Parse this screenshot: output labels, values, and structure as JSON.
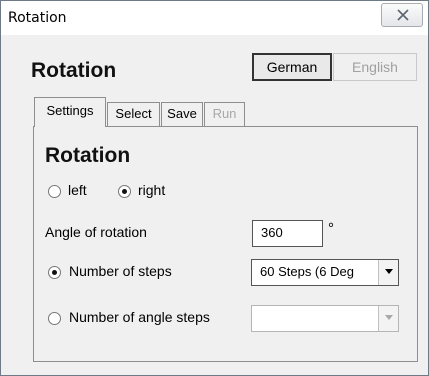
{
  "window": {
    "title": "Rotation",
    "close_glyph": "✕"
  },
  "header": {
    "title": "Rotation",
    "languages": [
      "German",
      "English"
    ],
    "active_language": "German"
  },
  "tabs": [
    {
      "label": "Settings",
      "active": true,
      "enabled": true
    },
    {
      "label": "Select",
      "active": false,
      "enabled": true
    },
    {
      "label": "Save",
      "active": false,
      "enabled": true
    },
    {
      "label": "Run",
      "active": false,
      "enabled": false
    }
  ],
  "settings": {
    "heading": "Rotation",
    "direction": {
      "options": [
        "left",
        "right"
      ],
      "selected": "right"
    },
    "angle": {
      "label": "Angle of rotation",
      "value": "360",
      "unit": "°"
    },
    "mode": {
      "steps_label": "Number of steps",
      "steps_value": "60 Steps  (6 Deg",
      "angle_steps_label": "Number of angle steps",
      "angle_steps_value": "",
      "selected": "steps"
    }
  }
}
